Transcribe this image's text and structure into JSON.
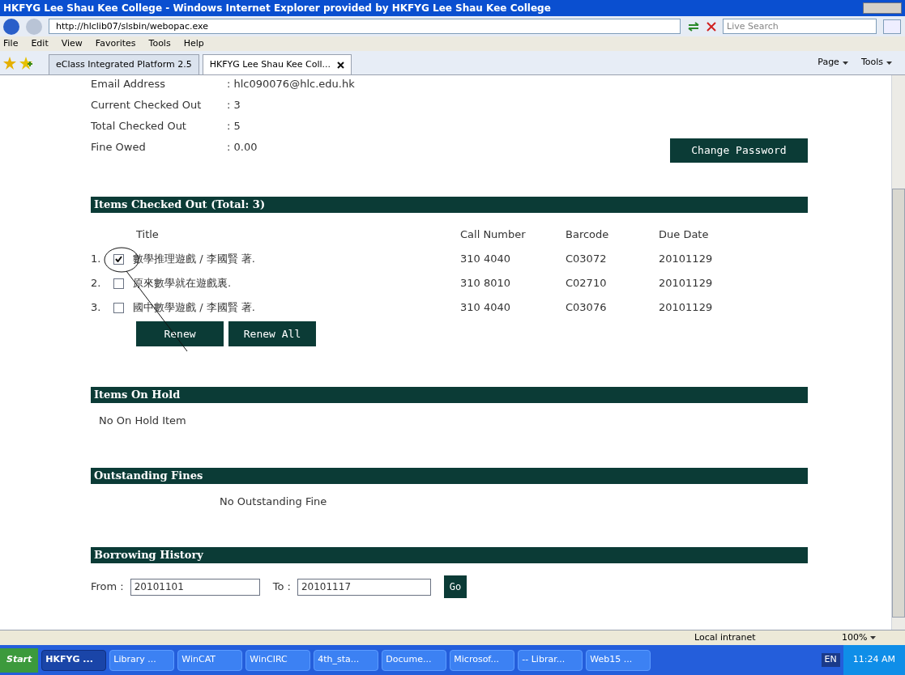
{
  "window": {
    "title": "HKFYG Lee Shau Kee College - Windows Internet Explorer provided by HKFYG Lee Shau Kee College"
  },
  "address_bar": {
    "url": "http://hlclib07/slsbin/webopac.exe",
    "search_placeholder": "Live Search"
  },
  "menu": [
    "File",
    "Edit",
    "View",
    "Favorites",
    "Tools",
    "Help"
  ],
  "tabs": [
    {
      "label": "eClass Integrated Platform 2.5",
      "selected": false
    },
    {
      "label": "HKFYG Lee Shau Kee Coll...",
      "selected": true
    }
  ],
  "command_bar": [
    "Page",
    "Tools"
  ],
  "account": [
    {
      "label": "Email Address",
      "value": ": hlc090076@hlc.edu.hk"
    },
    {
      "label": "Current Checked Out",
      "value": ": 3"
    },
    {
      "label": "Total Checked Out",
      "value": ": 5"
    },
    {
      "label": "Fine Owed",
      "value": ": 0.00"
    }
  ],
  "change_password": "Change Password",
  "checked_out": {
    "heading": "Items Checked Out (Total: 3)",
    "columns": [
      "Title",
      "Call Number",
      "Barcode",
      "Due Date"
    ],
    "rows": [
      {
        "number": "1.",
        "checked": true,
        "title": "數學推理遊戲 / 李國賢 著.",
        "call_number": "310 4040",
        "barcode": "C03072",
        "due": "20101129"
      },
      {
        "number": "2.",
        "checked": false,
        "title": "原來數學就在遊戲裏.",
        "call_number": "310 8010",
        "barcode": "C02710",
        "due": "20101129"
      },
      {
        "number": "3.",
        "checked": false,
        "title": "國中數學遊戲 / 李國賢 著.",
        "call_number": "310 4040",
        "barcode": "C03076",
        "due": "20101129"
      }
    ],
    "buttons": [
      "Renew",
      "Renew All"
    ]
  },
  "on_hold": {
    "heading": "Items On Hold",
    "message": "No On Hold Item"
  },
  "fines": {
    "heading": "Outstanding Fines",
    "message": "No Outstanding Fine"
  },
  "history": {
    "heading": "Borrowing History",
    "from_label": "From :",
    "from": "20101101",
    "to_label": "To :",
    "to": "20101117",
    "go": "Go"
  },
  "status_bar": {
    "zone": "Local intranet",
    "zoom": "100%"
  },
  "taskbar": {
    "start": "Start",
    "items": [
      {
        "label": "HKFYG ...",
        "selected": true
      },
      {
        "label": "Library ...",
        "selected": false
      },
      {
        "label": "WinCAT",
        "selected": false
      },
      {
        "label": "WinCIRC",
        "selected": false
      },
      {
        "label": "4th_sta...",
        "selected": false
      },
      {
        "label": "Docume...",
        "selected": false
      },
      {
        "label": "Microsof...",
        "selected": false
      },
      {
        "label": "-- Librar...",
        "selected": false
      },
      {
        "label": "Web15 ...",
        "selected": false
      }
    ],
    "language": "EN",
    "clock": "11:24 AM"
  }
}
